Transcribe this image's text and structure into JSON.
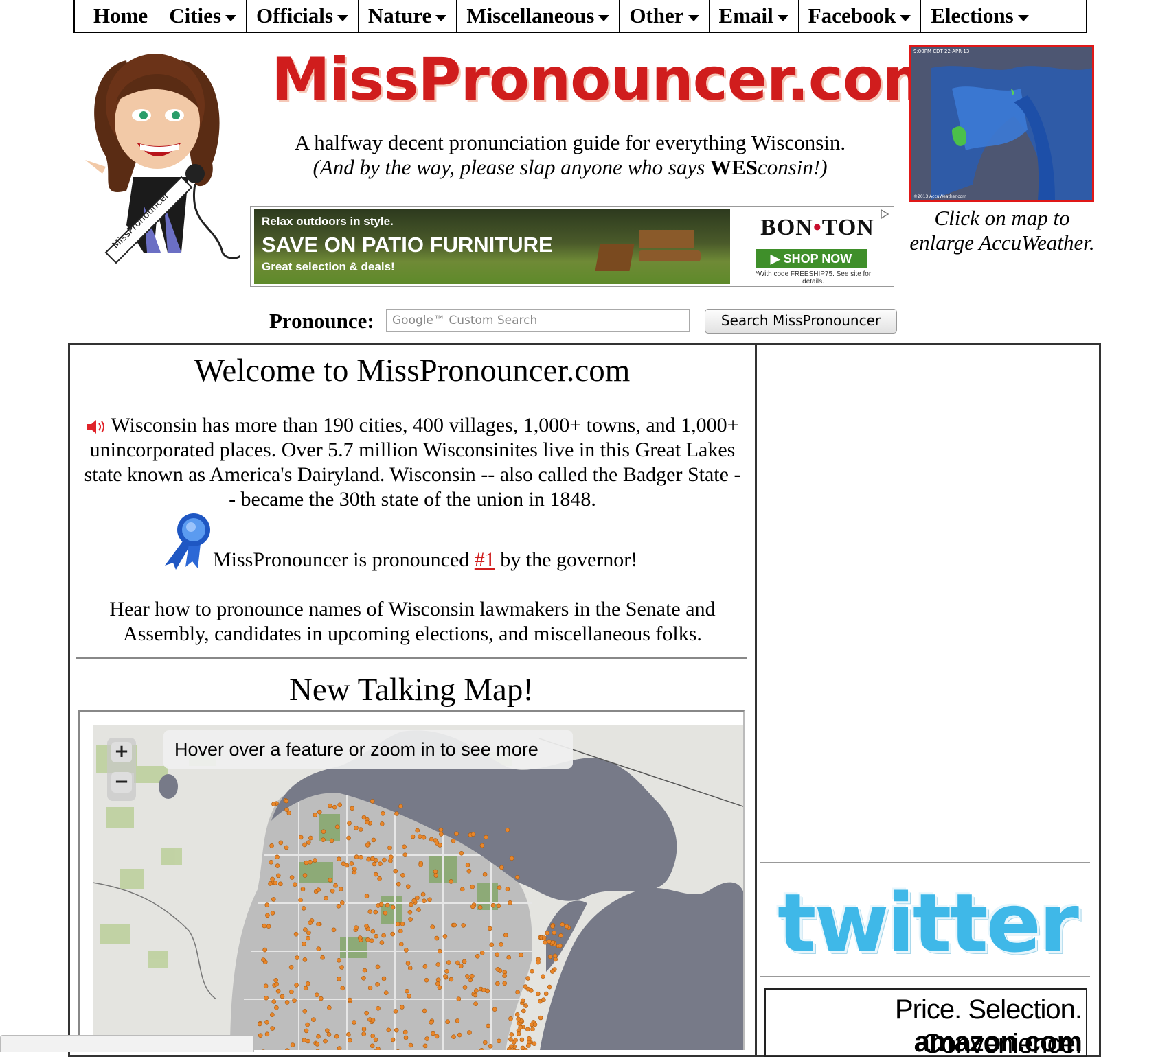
{
  "nav": {
    "items": [
      {
        "label": "Home",
        "dropdown": false
      },
      {
        "label": "Cities",
        "dropdown": true
      },
      {
        "label": "Officials",
        "dropdown": true
      },
      {
        "label": "Nature",
        "dropdown": true
      },
      {
        "label": "Miscellaneous",
        "dropdown": true
      },
      {
        "label": "Other",
        "dropdown": true
      },
      {
        "label": "Email",
        "dropdown": true
      },
      {
        "label": "Facebook",
        "dropdown": true
      },
      {
        "label": "Elections",
        "dropdown": true
      }
    ]
  },
  "header": {
    "logo": "MissPronouncer.com",
    "tagline": "A halfway decent pronunciation guide for everything Wisconsin.",
    "sub_prefix": "(And by the way, please slap anyone who says ",
    "sub_bold": "WES",
    "sub_suffix": "consin!)",
    "mascot_sash": "MissPronouncer"
  },
  "ad": {
    "small": "Relax outdoors in style.",
    "headline": "SAVE ON PATIO FURNITURE",
    "deal": "Great selection & deals!",
    "brand_left": "BON",
    "brand_dot": "•",
    "brand_right": "TON",
    "cta": "▶  SHOP NOW",
    "fine_print": "*With code FREESHIP75. See site for details."
  },
  "weather": {
    "timestamp": "9:00PM CDT 22-APR-13",
    "credit": "©2013 AccuWeather.com",
    "caption": "Click on map to enlarge AccuWeather."
  },
  "search": {
    "label": "Pronounce:",
    "placeholder": "Google™ Custom Search",
    "button": "Search MissPronouncer"
  },
  "main": {
    "welcome_title": "Welcome to MissPronouncer.com",
    "intro": "Wisconsin has more than 190 cities, 400 villages, 1,000+ towns, and 1,000+ unincorporated places. Over 5.7 million Wisconsinites live in this Great Lakes state known as America's Dairyland. Wisconsin -- also called the Badger State -- became the 30th state of the union in 1848.",
    "governor_prefix": "MissPronouncer is pronounced ",
    "governor_link": "#1",
    "governor_suffix": " by the governor!",
    "hear": "Hear how to pronounce names of Wisconsin lawmakers in the Senate and Assembly, candidates in upcoming elections, and miscellaneous folks.",
    "map_title": "New Talking Map!",
    "map_hint": "Hover over a feature or zoom in to see more",
    "zoom_in": "+",
    "zoom_out": "−"
  },
  "sidebar": {
    "twitter": "twitter",
    "amazon_tagline": "Price. Selection. Convenience.",
    "amazon_logo": "amazon.com"
  },
  "colors": {
    "accent_red": "#d01d1d",
    "twitter_blue": "#3fb8e8",
    "map_water": "#777a88",
    "map_dot": "#e8862a"
  }
}
